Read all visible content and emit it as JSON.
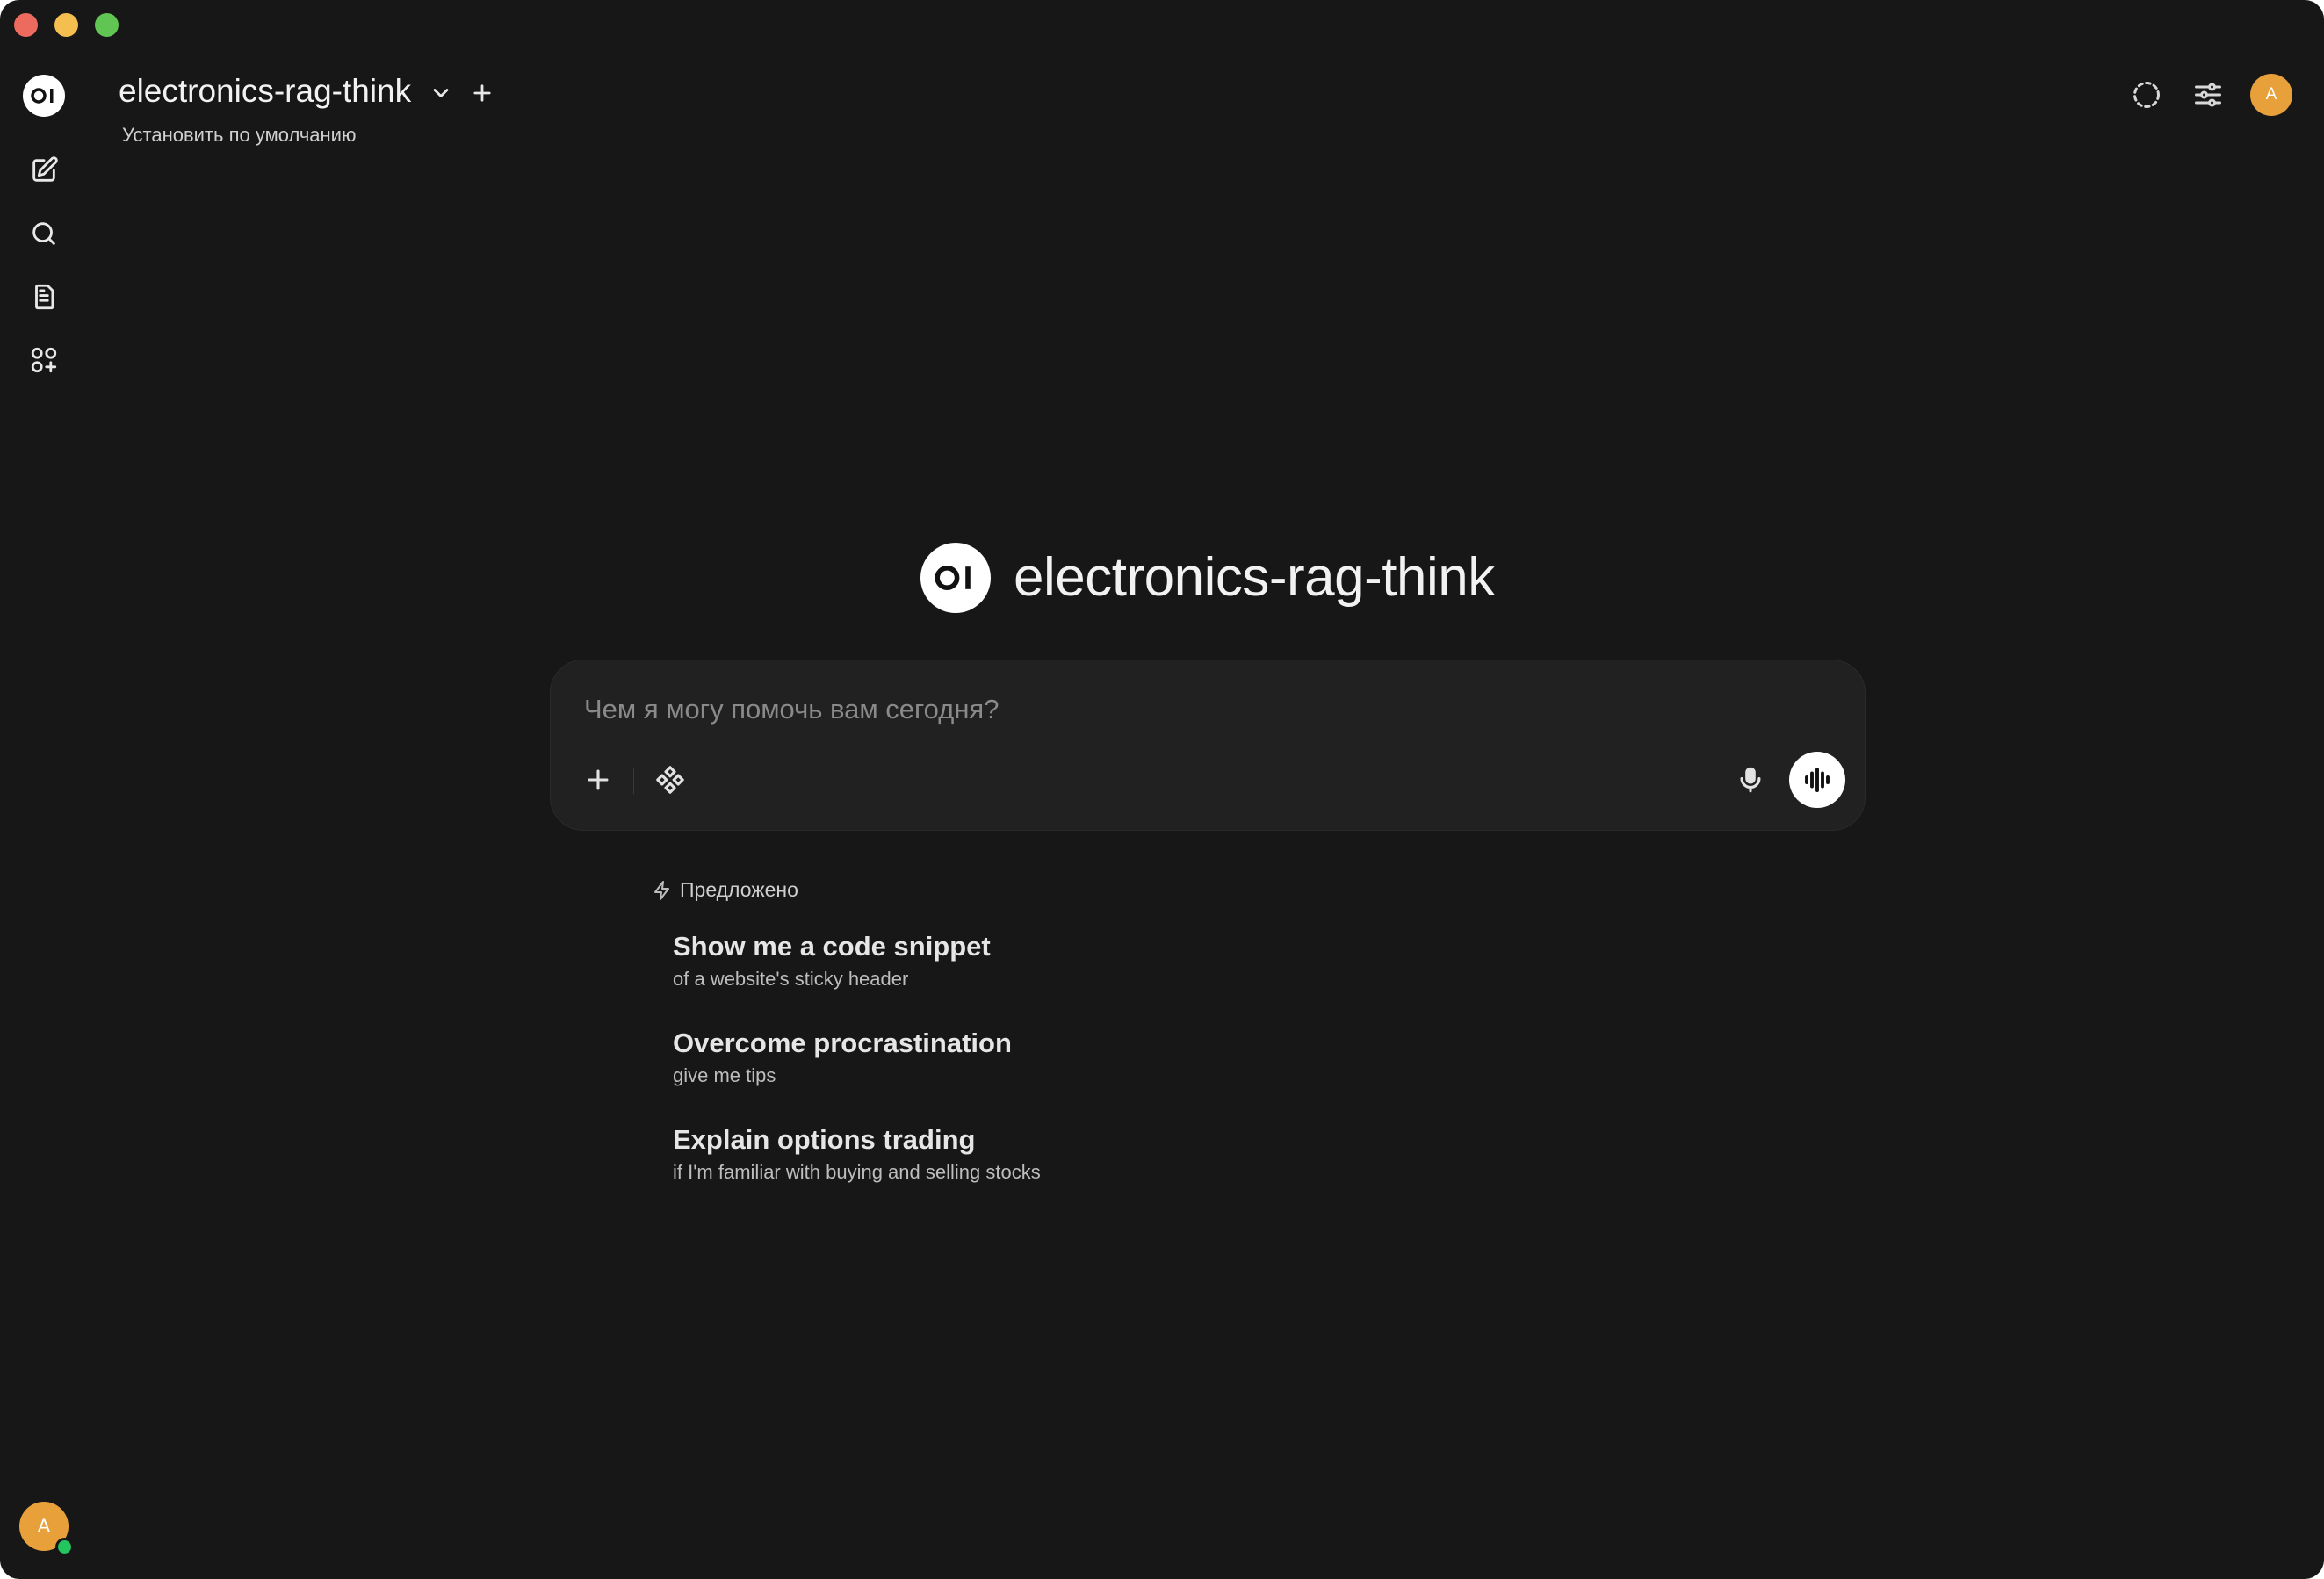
{
  "window": {
    "controls": [
      "close",
      "minimize",
      "maximize"
    ]
  },
  "sidebar": {
    "logo_icon": "open-webui-logo-icon",
    "items": [
      {
        "name": "new-chat",
        "icon": "edit-icon"
      },
      {
        "name": "search",
        "icon": "search-icon"
      },
      {
        "name": "notes",
        "icon": "document-icon"
      },
      {
        "name": "workspace",
        "icon": "apps-plus-icon"
      }
    ],
    "user_avatar_initial": "A",
    "status_color": "#22c55e"
  },
  "header": {
    "model_name": "electronics-rag-think",
    "set_default_label": "Установить по умолчанию",
    "user_avatar_initial": "A",
    "avatar_color": "#e8a13a"
  },
  "main": {
    "title": "electronics-rag-think",
    "composer": {
      "placeholder": "Чем я могу помочь вам сегодня?",
      "value": ""
    },
    "suggestions_label": "Предложено",
    "suggestions": [
      {
        "title": "Show me a code snippet",
        "subtitle": "of a website's sticky header"
      },
      {
        "title": "Overcome procrastination",
        "subtitle": "give me tips"
      },
      {
        "title": "Explain options trading",
        "subtitle": "if I'm familiar with buying and selling stocks"
      }
    ]
  },
  "colors": {
    "background": "#171717",
    "composer_bg": "#212121",
    "accent_avatar": "#e8a13a"
  }
}
